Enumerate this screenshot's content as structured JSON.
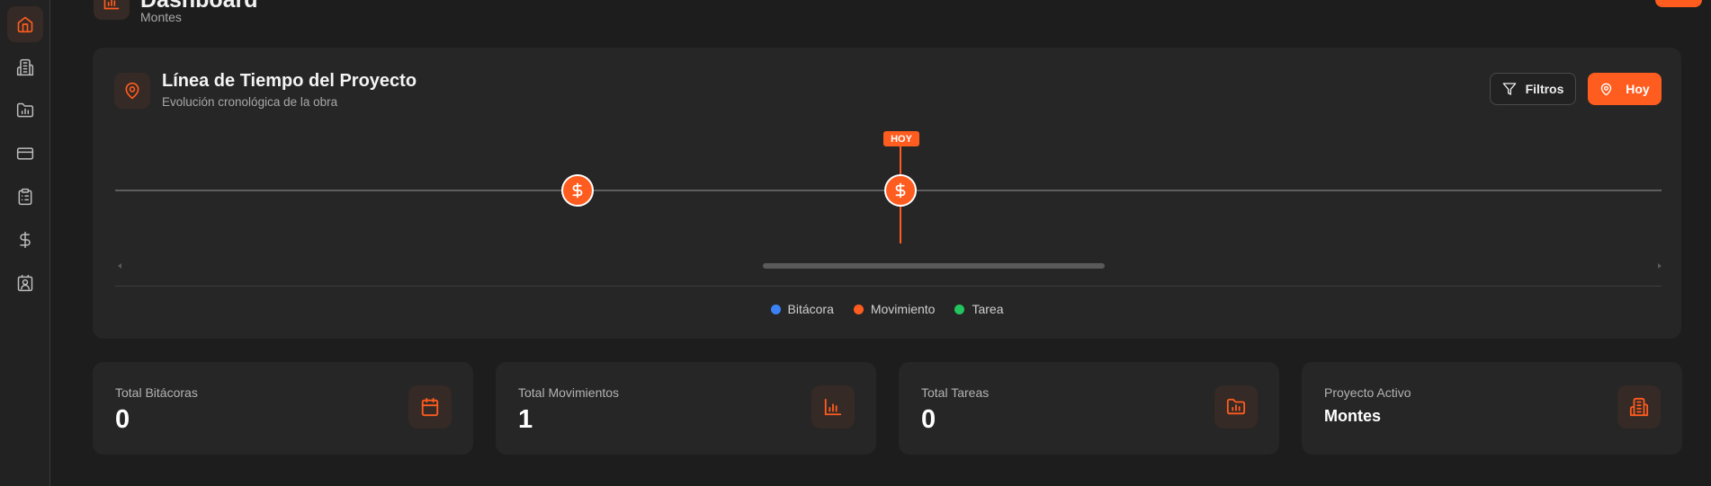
{
  "header": {
    "title": "Dashboard",
    "subtitle": "Montes"
  },
  "sidebar": {
    "items": [
      {
        "icon": "home-icon",
        "active": true
      },
      {
        "icon": "building-icon",
        "active": false
      },
      {
        "icon": "folder-chart-icon",
        "active": false
      },
      {
        "icon": "credit-card-icon",
        "active": false
      },
      {
        "icon": "clipboard-icon",
        "active": false
      },
      {
        "icon": "dollar-icon",
        "active": false
      },
      {
        "icon": "contact-icon",
        "active": false
      }
    ]
  },
  "timeline": {
    "title": "Línea de Tiempo del Proyecto",
    "subtitle": "Evolución cronológica de la obra",
    "filter_label": "Filtros",
    "today_button_label": "Hoy",
    "today_marker_label": "HOY",
    "legend": [
      {
        "label": "Bitácora",
        "color": "#3b82f6"
      },
      {
        "label": "Movimiento",
        "color": "#ff5c1f"
      },
      {
        "label": "Tarea",
        "color": "#22c55e"
      }
    ]
  },
  "stats": [
    {
      "label": "Total Bitácoras",
      "value": "0",
      "icon": "calendar-icon"
    },
    {
      "label": "Total Movimientos",
      "value": "1",
      "icon": "bar-chart-icon"
    },
    {
      "label": "Total Tareas",
      "value": "0",
      "icon": "folder-chart-icon"
    },
    {
      "label": "Proyecto Activo",
      "value": "Montes",
      "icon": "building-icon"
    }
  ],
  "colors": {
    "accent": "#ff5c1f",
    "background": "#1d1d1d",
    "card": "#262626"
  }
}
